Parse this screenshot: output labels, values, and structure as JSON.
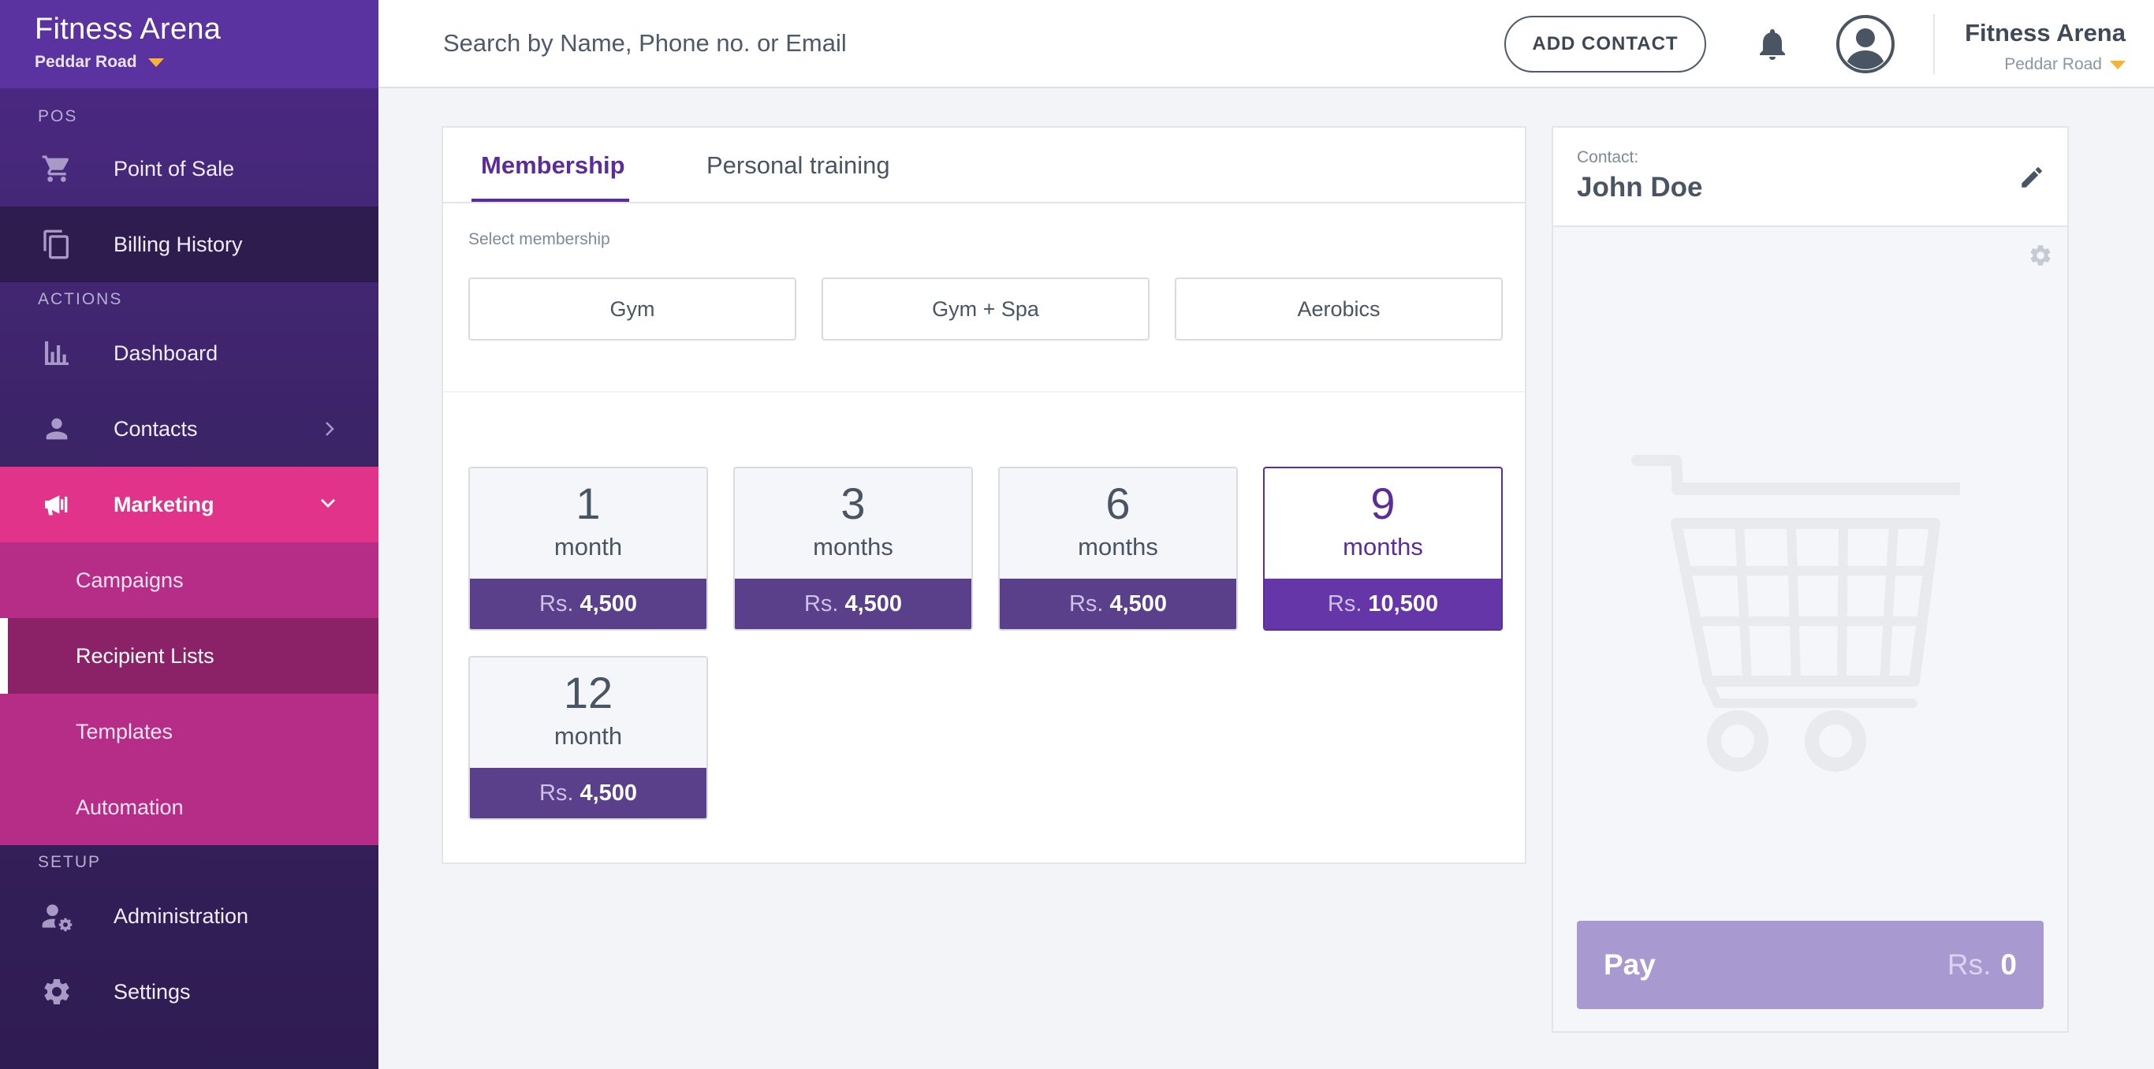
{
  "sidebar": {
    "brand": {
      "name": "Fitness Arena",
      "location": "Peddar Road"
    },
    "sections": {
      "pos": "POS",
      "actions": "ACTIONS",
      "setup": "SETUP"
    },
    "items": {
      "point_of_sale": "Point of Sale",
      "billing_history": "Billing History",
      "dashboard": "Dashboard",
      "contacts": "Contacts",
      "marketing": "Marketing",
      "campaigns": "Campaigns",
      "recipient_lists": "Recipient Lists",
      "templates": "Templates",
      "automation": "Automation",
      "administration": "Administration",
      "settings": "Settings"
    }
  },
  "header": {
    "search_placeholder": "Search by Name, Phone no. or Email",
    "add_contact": "ADD CONTACT",
    "brand_name": "Fitness Arena",
    "location": "Peddar Road"
  },
  "tabs": [
    "Membership",
    "Personal training"
  ],
  "select_label": "Select membership",
  "categories": [
    "Gym",
    "Gym + Spa",
    "Aerobics"
  ],
  "plans": [
    {
      "num": "1",
      "unit": "month",
      "currency": "Rs.",
      "price": "4,500"
    },
    {
      "num": "3",
      "unit": "months",
      "currency": "Rs.",
      "price": "4,500"
    },
    {
      "num": "6",
      "unit": "months",
      "currency": "Rs.",
      "price": "4,500"
    },
    {
      "num": "9",
      "unit": "months",
      "currency": "Rs.",
      "price": "10,500",
      "selected": true
    },
    {
      "num": "12",
      "unit": "month",
      "currency": "Rs.",
      "price": "4,500"
    }
  ],
  "cart": {
    "contact_label": "Contact:",
    "contact_name": "John Doe",
    "pay_label": "Pay",
    "currency": "Rs.",
    "total": "0"
  },
  "colors": {
    "accent": "#5a2d99",
    "marketing_active": "#e2338b",
    "submenu": "#b52d87",
    "pay_button": "#a899d0"
  }
}
